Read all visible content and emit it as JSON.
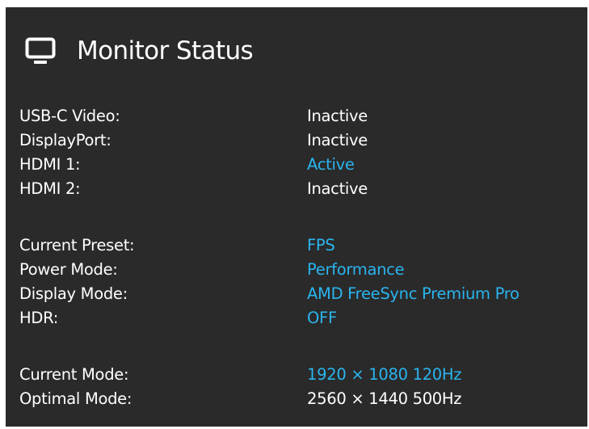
{
  "window": {
    "title": "Monitor Status",
    "icon": "monitor-icon"
  },
  "colors": {
    "background": "#2a2a2a",
    "text": "#ffffff",
    "accent": "#2ab4ee"
  },
  "inputs": [
    {
      "label": "USB-C Video:",
      "value": "Inactive",
      "highlighted": false
    },
    {
      "label": "DisplayPort:",
      "value": "Inactive",
      "highlighted": false
    },
    {
      "label": "HDMI 1:",
      "value": "Active",
      "highlighted": true
    },
    {
      "label": "HDMI 2:",
      "value": "Inactive",
      "highlighted": false
    }
  ],
  "settings": [
    {
      "label": "Current Preset:",
      "value": "FPS",
      "highlighted": true
    },
    {
      "label": "Power Mode:",
      "value": "Performance",
      "highlighted": true
    },
    {
      "label": "Display Mode:",
      "value": "AMD FreeSync Premium Pro",
      "highlighted": true
    },
    {
      "label": "HDR:",
      "value": "OFF",
      "highlighted": true
    }
  ],
  "modes": [
    {
      "label": "Current Mode:",
      "value": "1920 × 1080  120Hz",
      "highlighted": true
    },
    {
      "label": "Optimal Mode:",
      "value": "2560 × 1440  500Hz",
      "highlighted": false
    }
  ]
}
